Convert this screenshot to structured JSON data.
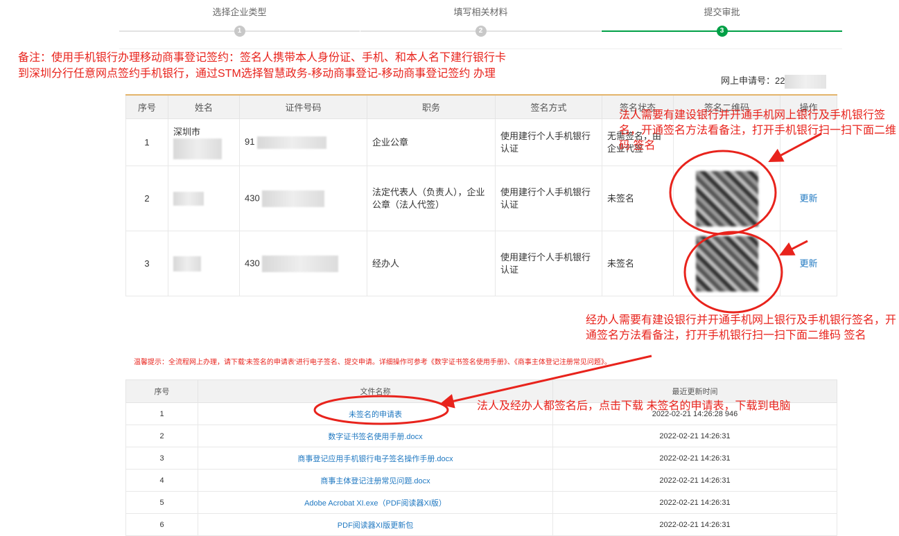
{
  "stepper": {
    "steps": [
      {
        "label": "选择企业类型",
        "num": "1"
      },
      {
        "label": "填写相关材料",
        "num": "2"
      },
      {
        "label": "提交审批",
        "num": "3"
      }
    ]
  },
  "note": {
    "line1": "备注：使用手机银行办理移动商事登记签约：签名人携带本人身份证、手机、和本人名下建行银行卡",
    "line2": "到深圳分行任意网点签约手机银行，通过STM选择智慧政务-移动商事登记-移动商事登记签约 办理"
  },
  "apply_no": {
    "label": "网上申请号：",
    "prefix": "22"
  },
  "sign_table": {
    "headers": [
      "序号",
      "姓名",
      "证件号码",
      "职务",
      "签名方式",
      "签名状态",
      "签名二维码",
      "操作"
    ],
    "rows": [
      {
        "no": "1",
        "name": "深圳市",
        "id": "91",
        "role": "企业公章",
        "method": "使用建行个人手机银行认证",
        "status": "无需签名，由企业代签"
      },
      {
        "no": "2",
        "name": "",
        "id": "430",
        "role": "法定代表人（负责人），企业公章（法人代签）",
        "method": "使用建行个人手机银行认证",
        "status": "未签名",
        "action": "更新"
      },
      {
        "no": "3",
        "name": "",
        "id": "430",
        "role": "经办人",
        "method": "使用建行个人手机银行认证",
        "status": "未签名",
        "action": "更新"
      }
    ]
  },
  "tip": "温馨提示：全流程网上办理，请下载'未签名的申请表'进行电子签名、提交申请。详细操作可参考《数字证书签名使用手册》、《商事主体登记注册常见问题》。",
  "file_table": {
    "headers": [
      "序号",
      "文件名称",
      "最近更新时间"
    ],
    "rows": [
      {
        "no": "1",
        "name": "未签名的申请表",
        "time": "2022-02-21 14:26:28 946"
      },
      {
        "no": "2",
        "name": "数字证书签名使用手册.docx",
        "time": "2022-02-21 14:26:31"
      },
      {
        "no": "3",
        "name": "商事登记应用手机银行电子签名操作手册.docx",
        "time": "2022-02-21 14:26:31"
      },
      {
        "no": "4",
        "name": "商事主体登记注册常见问题.docx",
        "time": "2022-02-21 14:26:31"
      },
      {
        "no": "5",
        "name": "Adobe Acrobat XI.exe（PDF阅读器XI版）",
        "time": "2022-02-21 14:26:31"
      },
      {
        "no": "6",
        "name": "PDF阅读器XI版更新包",
        "time": "2022-02-21 14:26:31"
      }
    ]
  },
  "annotations": {
    "legal": "法人需要有建设银行并开通手机网上银行及手机银行签名，开通签名方法看备注，打开手机银行扫一扫下面二维码 签名",
    "handler": "经办人需要有建设银行并开通手机网上银行及手机银行签名，开通签名方法看备注，打开手机银行扫一扫下面二维码 签名",
    "download": "法人及经办人都签名后，点击下载 未签名的申请表，下载到电脑"
  },
  "colors": {
    "accent": "#00a046",
    "annotation": "#e8231c",
    "link": "#1f78c1"
  }
}
